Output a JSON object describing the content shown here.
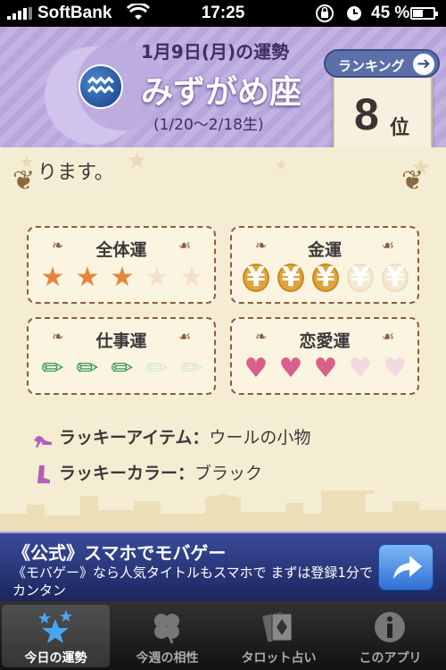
{
  "status": {
    "carrier": "SoftBank",
    "time": "17:25",
    "battery_pct": "45 %",
    "battery_level": 0.45
  },
  "header": {
    "date_title": "1月9日(月)の運勢",
    "sign_name": "みずがめ座",
    "date_range": "(1/20〜2/18生)",
    "ranking_label": "ランキング",
    "rank_number": "8",
    "rank_unit": "位",
    "emblem_icon": "aquarius-icon"
  },
  "content": {
    "description": "ります。",
    "fortunes": [
      {
        "title": "全体運",
        "kind": "star",
        "rating": 3,
        "max": 5
      },
      {
        "title": "金運",
        "kind": "yen-coin",
        "rating": 3,
        "max": 5
      },
      {
        "title": "仕事運",
        "kind": "pencil",
        "rating": 3,
        "max": 5
      },
      {
        "title": "恋愛運",
        "kind": "heart",
        "rating": 3,
        "max": 5
      }
    ],
    "lucky": [
      {
        "label": "ラッキーアイテム",
        "sep": "：",
        "value": "ウールの小物",
        "icon": "high-heel-icon"
      },
      {
        "label": "ラッキーカラー",
        "sep": "：",
        "value": "ブラック",
        "icon": "boot-icon"
      }
    ]
  },
  "ad": {
    "title": "《公式》スマホでモバゲー",
    "body": "《モバゲー》なら人気タイトルもスマホで まずは登録1分でカンタン"
  },
  "tabs": [
    {
      "label": "今日の運勢",
      "icon": "stars-icon",
      "active": true
    },
    {
      "label": "今週の相性",
      "icon": "clover-icon",
      "active": false
    },
    {
      "label": "タロット占い",
      "icon": "tarot-card-icon",
      "active": false
    },
    {
      "label": "このアプリ",
      "icon": "info-icon",
      "active": false
    }
  ],
  "colors": {
    "header": "#b7a6dc",
    "background": "#f5edd3",
    "star": "#e6853a",
    "coin": "#e0a33a",
    "pencil": "#3a9a55",
    "heart": "#d9608b",
    "ad": "#1b275e"
  }
}
